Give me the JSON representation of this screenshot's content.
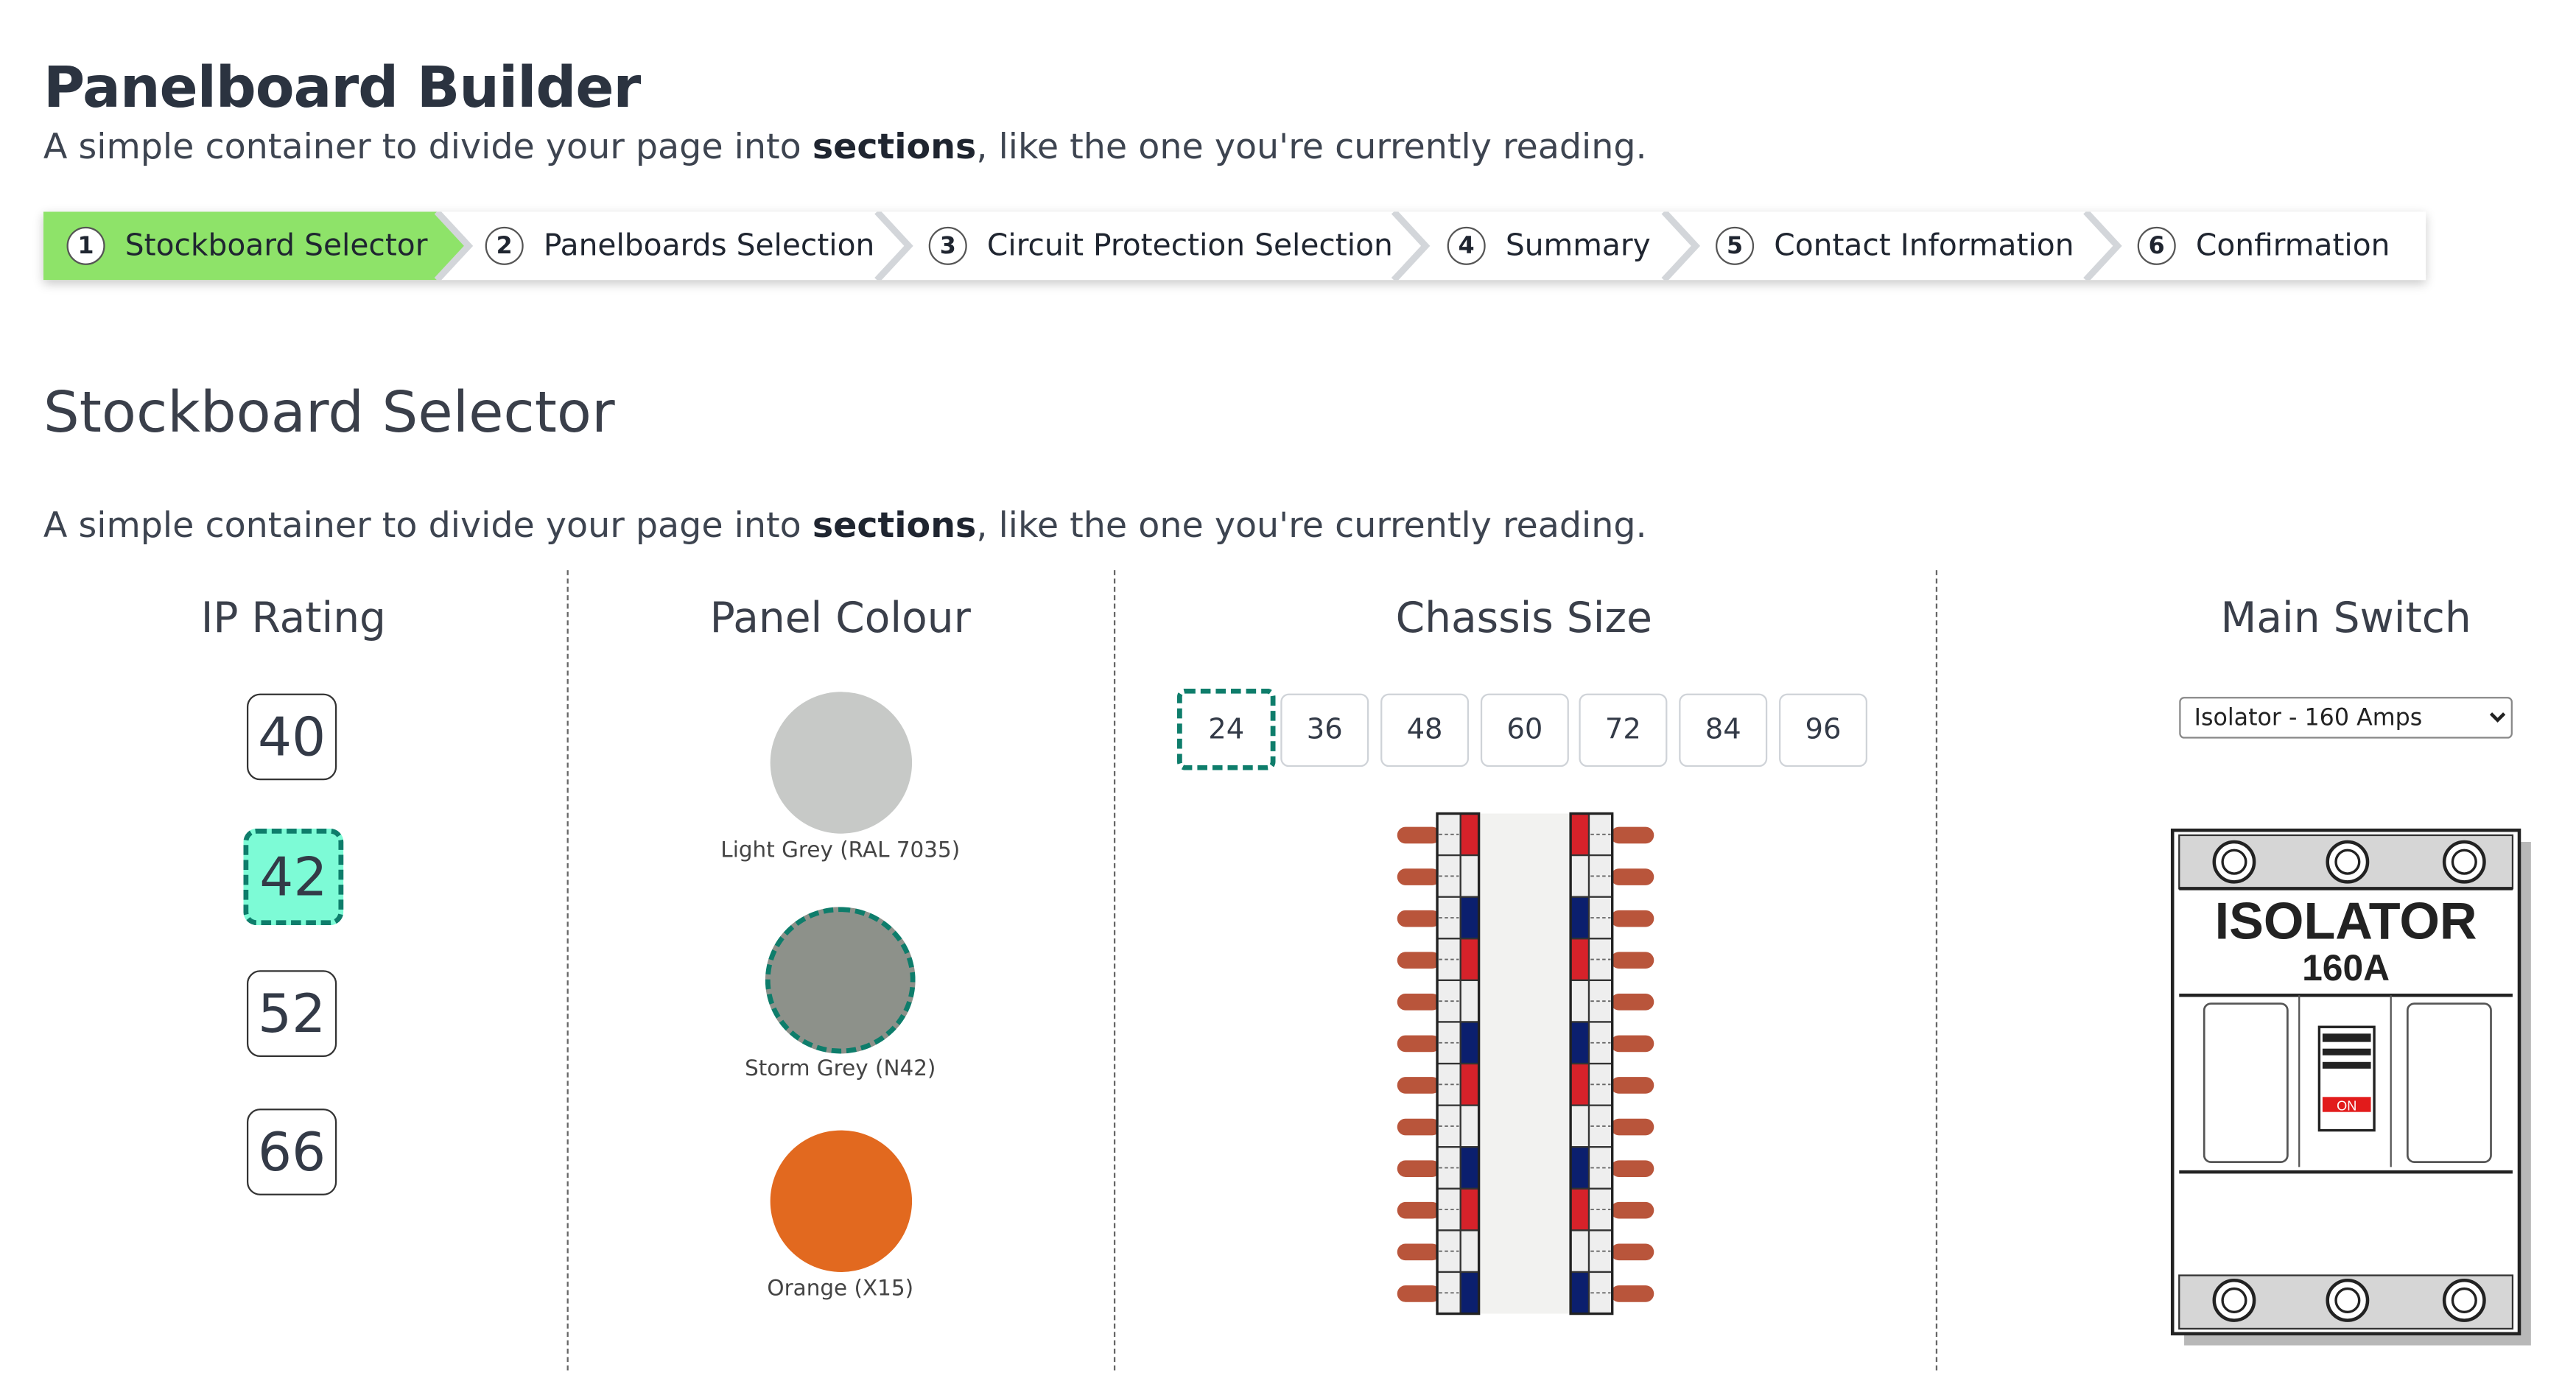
{
  "page": {
    "title": "Panelboard Builder",
    "subtitle_prefix": "A simple container to divide your page into ",
    "subtitle_bold": "sections",
    "subtitle_suffix": ", like the one you're currently reading."
  },
  "stepper": {
    "active_color": "#8ee369",
    "steps": [
      {
        "num": "1",
        "label": "Stockboard Selector",
        "active": true
      },
      {
        "num": "2",
        "label": "Panelboards Selection",
        "active": false
      },
      {
        "num": "3",
        "label": "Circuit Protection Selection",
        "active": false
      },
      {
        "num": "4",
        "label": "Summary",
        "active": false
      },
      {
        "num": "5",
        "label": "Contact Information",
        "active": false
      },
      {
        "num": "6",
        "label": "Confirmation",
        "active": false
      }
    ]
  },
  "section": {
    "title": "Stockboard Selector",
    "desc_prefix": "A simple container to divide your page into ",
    "desc_bold": "sections",
    "desc_suffix": ", like the one you're currently reading."
  },
  "ip_rating": {
    "title": "IP Rating",
    "options": [
      "40",
      "42",
      "52",
      "66"
    ],
    "selected": "42",
    "selected_color": "#7dfbd6"
  },
  "panel_colour": {
    "title": "Panel Colour",
    "options": [
      {
        "label": "Light Grey (RAL 7035)",
        "color": "#c7c9c7",
        "selected": false
      },
      {
        "label": "Storm Grey (N42)",
        "color": "#8d918a",
        "selected": true
      },
      {
        "label": "Orange (X15)",
        "color": "#e2691f",
        "selected": false
      }
    ]
  },
  "chassis_size": {
    "title": "Chassis Size",
    "options": [
      "24",
      "36",
      "48",
      "60",
      "72",
      "84",
      "96"
    ],
    "selected": "24"
  },
  "main_switch": {
    "title": "Main Switch",
    "selected": "Isolator - 160 Amps",
    "options": [
      "Isolator - 160 Amps"
    ],
    "graphic": {
      "line1": "ISOLATOR",
      "line2": "160A",
      "state": "ON"
    }
  },
  "colors": {
    "selected_border": "#0e7d6b",
    "phase_red": "#d6222a",
    "phase_blue": "#0b1f6e",
    "terminal": "#b9553b"
  }
}
